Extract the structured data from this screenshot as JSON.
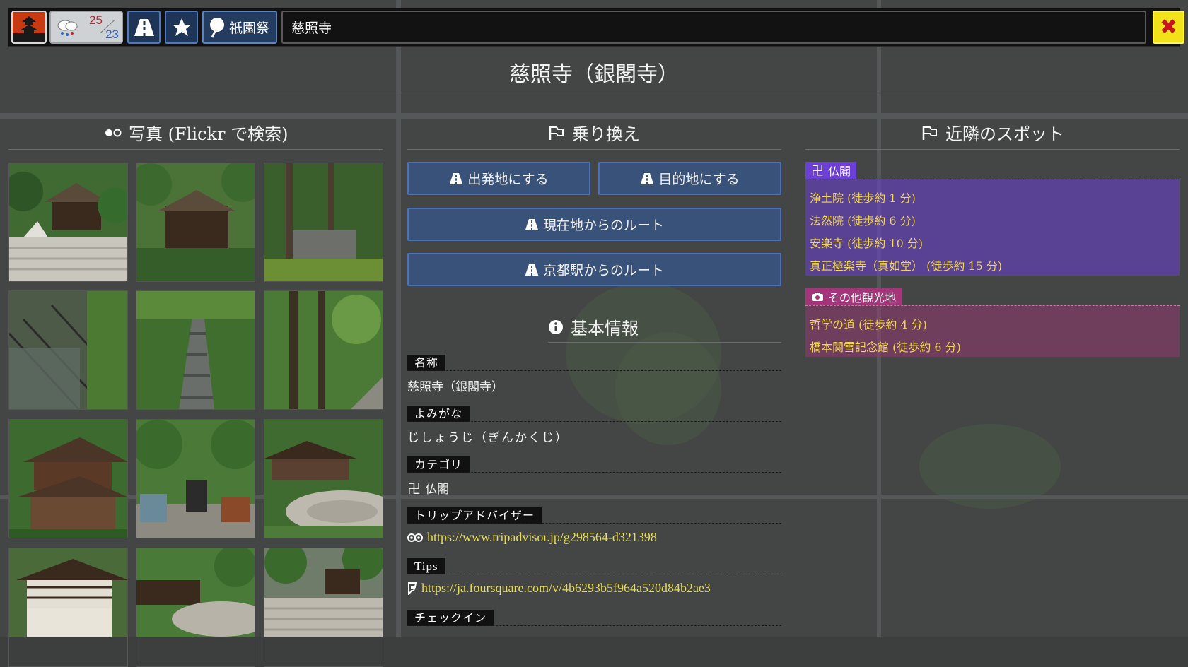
{
  "header": {
    "weather": {
      "temp_high": "25",
      "temp_low": "23"
    },
    "festival_label": "祇園祭",
    "search": {
      "value": "慈照寺"
    },
    "close_icon": "close-icon",
    "colors": {
      "accent": "#4b72b8",
      "close": "#f2e21a",
      "logo": "#c73a12"
    }
  },
  "page": {
    "title": "慈照寺（銀閣寺）"
  },
  "photos": {
    "heading": "写真 (Flickr で検索)",
    "count": 12
  },
  "transfer": {
    "heading": "乗り換え",
    "buttons": {
      "set_origin": "出発地にする",
      "set_destination": "目的地にする",
      "from_current": "現在地からのルート",
      "from_kyoto_station": "京都駅からのルート"
    }
  },
  "info": {
    "heading": "基本情報",
    "name_label": "名称",
    "name_value": "慈照寺（銀閣寺）",
    "reading_label": "よみがな",
    "reading_value": "じしょうじ（ぎんかくじ）",
    "category_label": "カテゴリ",
    "category_value": "仏閣",
    "tripadvisor_label": "トリップアドバイザー",
    "tripadvisor_url": "https://www.tripadvisor.jp/g298564-d321398",
    "tips_label": "Tips",
    "tips_url": "https://ja.foursquare.com/v/4b6293b5f964a520d84b2ae3",
    "checkin_label": "チェックイン"
  },
  "nearby": {
    "heading": "近隣のスポット",
    "groups": [
      {
        "label": "仏閣",
        "color": "#6c3fd6",
        "items": [
          "浄土院 (徒歩約 1 分)",
          "法然院 (徒歩約 6 分)",
          "安楽寺 (徒歩約 10 分)",
          "真正極楽寺（真如堂） (徒歩約 15 分)"
        ]
      },
      {
        "label": "その他観光地",
        "color": "#a5357a",
        "items": [
          "哲学の道 (徒歩約 4 分)",
          "橋本関雪記念館 (徒歩約 6 分)"
        ]
      }
    ]
  }
}
